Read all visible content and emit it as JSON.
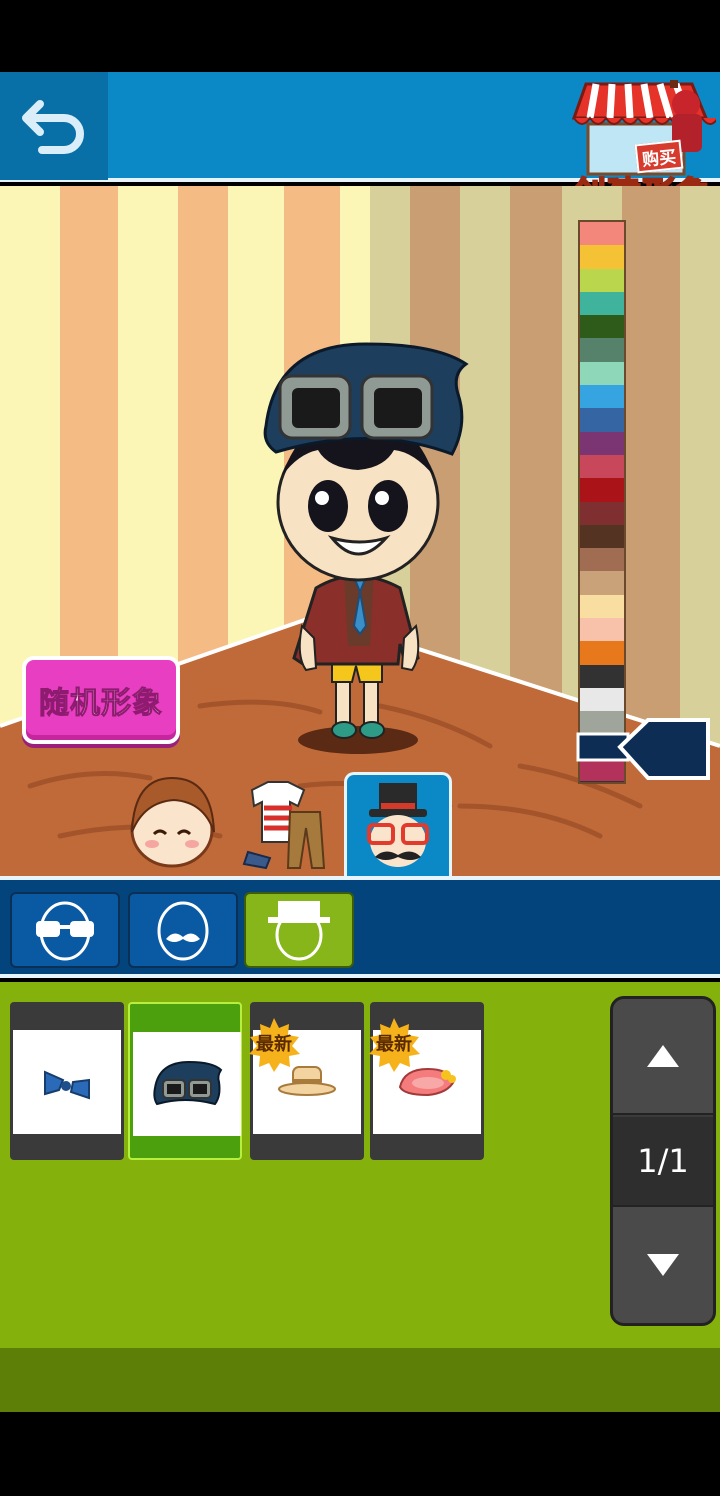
{
  "header": {
    "back_icon": "back-arrow-icon",
    "shop_label": "创建形象",
    "buy_tag": "购买"
  },
  "scene": {
    "random_button_label": "随机形象"
  },
  "palette": {
    "colors": [
      "#f4877c",
      "#f5c236",
      "#b9d64c",
      "#3fb39c",
      "#2f5b1a",
      "#56826c",
      "#8ed7b8",
      "#35a4e1",
      "#3566a3",
      "#7b3573",
      "#c8475b",
      "#aa1418",
      "#7f2f2f",
      "#553322",
      "#a06c52",
      "#c9a27a",
      "#f9dea2",
      "#f8c2aa",
      "#e8781c",
      "#323232",
      "#e8e8e8",
      "#9fa59b",
      "#0e2d55",
      "#b2325c"
    ],
    "selected_color": "#0e2d55"
  },
  "category_tabs": [
    {
      "name": "face",
      "icon": "face-icon",
      "active": false
    },
    {
      "name": "clothes",
      "icon": "clothes-icon",
      "active": false
    },
    {
      "name": "accessories",
      "icon": "accessories-icon",
      "active": true
    }
  ],
  "sub_tabs": [
    {
      "icon": "glasses-icon",
      "active": false
    },
    {
      "icon": "mustache-icon",
      "active": false
    },
    {
      "icon": "hat-icon",
      "active": true
    }
  ],
  "items": [
    {
      "icon": "bow-tie-icon",
      "new_label": "",
      "selected": false
    },
    {
      "icon": "beanie-goggles-icon",
      "new_label": "",
      "selected": true
    },
    {
      "icon": "straw-hat-icon",
      "new_label": "最新",
      "selected": false
    },
    {
      "icon": "pink-hat-icon",
      "new_label": "最新",
      "selected": false
    }
  ],
  "pager": {
    "page_text": "1/1"
  }
}
